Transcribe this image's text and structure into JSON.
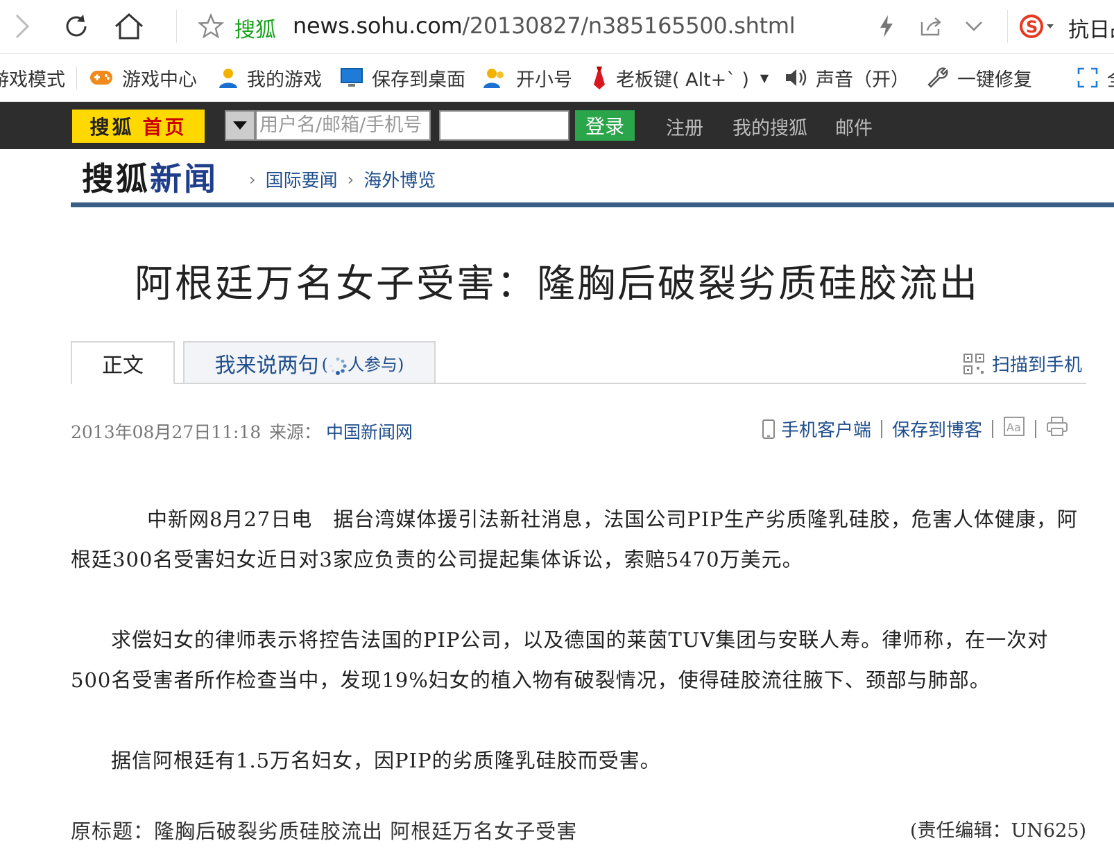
{
  "browser": {
    "site_name": "搜狐",
    "url_host": "news.sohu.com",
    "url_path": "/20130827/n385165500.shtml",
    "search_label": "抗日战"
  },
  "favorites": {
    "items": [
      {
        "label": "游戏模式",
        "icon": "game-mode-icon"
      },
      {
        "label": "游戏中心",
        "icon": "gamepad-icon"
      },
      {
        "label": "我的游戏",
        "icon": "user-icon"
      },
      {
        "label": "保存到桌面",
        "icon": "monitor-icon"
      },
      {
        "label": "开小号",
        "icon": "users-icon"
      },
      {
        "label": "老板键( Alt+` )",
        "icon": "boss-key-icon"
      },
      {
        "label": "声音（开）",
        "icon": "speaker-icon"
      },
      {
        "label": "一键修复",
        "icon": "wrench-icon"
      },
      {
        "label": "全",
        "icon": "fullscreen-icon"
      }
    ]
  },
  "sohu_bar": {
    "home_brand": "搜狐",
    "home_label": "首页",
    "username_placeholder": "用户名/邮箱/手机号",
    "login_label": "登录",
    "links": [
      "注册",
      "我的搜狐",
      "邮件"
    ]
  },
  "news_header": {
    "logo_a": "搜狐",
    "logo_b": "新闻",
    "breadcrumb": [
      "国际要闻",
      "海外博览"
    ]
  },
  "article": {
    "title": "阿根廷万名女子受害：隆胸后破裂劣质硅胶流出",
    "tab_main": "正文",
    "tab_comment": "我来说两句",
    "tab_comment_suffix": "人参与)",
    "tab_comment_prefix": "(",
    "scan_label": "扫描到手机",
    "date": "2013年08月27日11:18",
    "source_label": "来源：",
    "source": "中国新闻网",
    "tools": [
      "手机客户端",
      "保存到博客"
    ],
    "paragraphs": [
      "中新网8月27日电　据台湾媒体援引法新社消息，法国公司PIP生产劣质隆乳硅胶，危害人体健康，阿根廷300名受害妇女近日对3家应负责的公司提起集体诉讼，索赔5470万美元。",
      "求偿妇女的律师表示将控告法国的PIP公司，以及德国的莱茵TUV集团与安联人寿。律师称，在一次对500名受害者所作检查当中，发现19%妇女的植入物有破裂情况，使得硅胶流往腋下、颈部与肺部。",
      "据信阿根廷有1.5万名妇女，因PIP的劣质隆乳硅胶而受害。"
    ],
    "original_title": "原标题：隆胸后破裂劣质硅胶流出 阿根廷万名女子受害",
    "editor": "(责任编辑：UN625)"
  }
}
